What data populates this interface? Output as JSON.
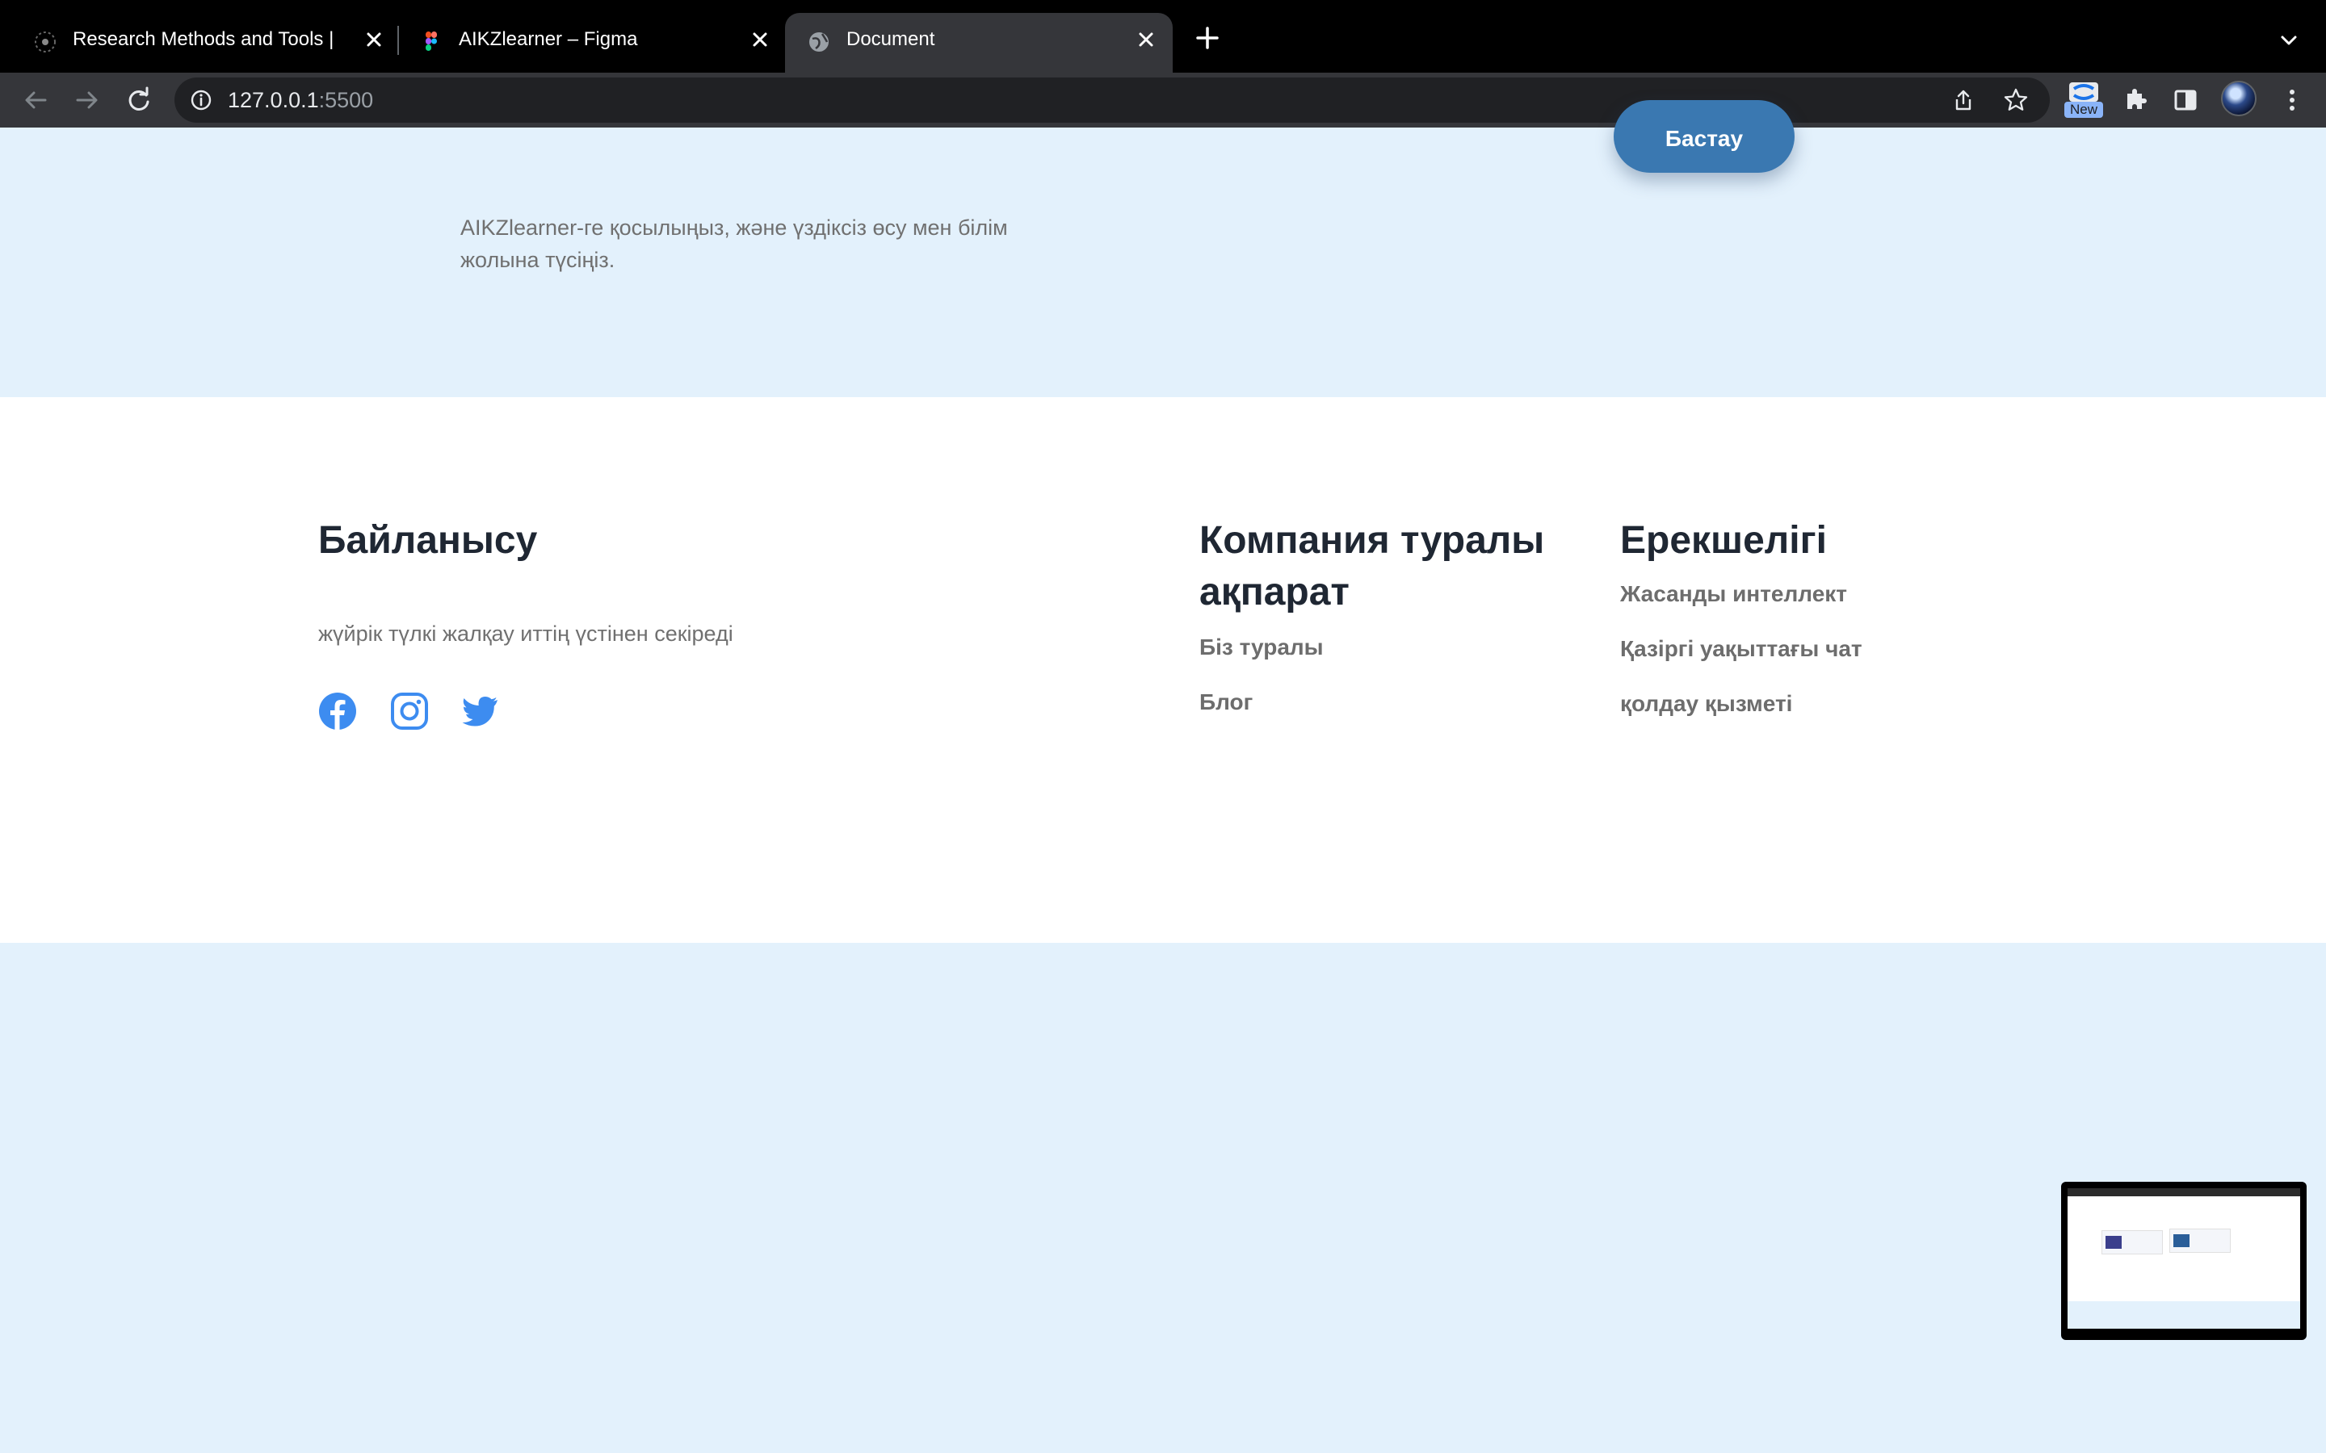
{
  "browser": {
    "tabs": [
      {
        "title": "Research Methods and Tools | ",
        "active": false,
        "icon": "research-favicon"
      },
      {
        "title": "AIKZlearner – Figma",
        "active": false,
        "icon": "figma-favicon"
      },
      {
        "title": "Document",
        "active": true,
        "icon": "globe-favicon"
      }
    ],
    "url_host": "127.0.0.1",
    "url_port": ":5500",
    "extension_badge": "New"
  },
  "cta": {
    "button_label": "Бастау",
    "text": "AIKZlearner-ге қосылыңыз, және үздіксіз өсу мен білім жолына түсіңіз."
  },
  "footer": {
    "contact": {
      "title": "Байланысу",
      "description": "жүйрік түлкі жалқау иттің үстінен секіреді",
      "social": [
        "facebook-icon",
        "instagram-icon",
        "twitter-icon"
      ]
    },
    "company": {
      "title": "Компания туралы ақпарат",
      "links": [
        "Біз туралы",
        "Блог"
      ]
    },
    "features": {
      "title": "Ерекшелігі",
      "links": [
        "Жасанды интеллект",
        "Қазіргі уақыттағы чат",
        "қолдау қызметі"
      ]
    }
  },
  "colors": {
    "page_bg": "#e3f1fc",
    "button": "#3a78b1",
    "heading": "#1f2733",
    "social": "#3d8cf0"
  }
}
